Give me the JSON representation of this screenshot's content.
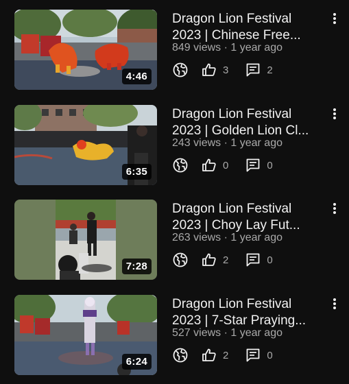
{
  "videos": [
    {
      "title_line1": "Dragon Lion Festival",
      "title_line2": "2023 | Chinese Free...",
      "views": "849 views",
      "age": "1 year ago",
      "duration": "4:46",
      "likes": "3",
      "comments": "2"
    },
    {
      "title_line1": "Dragon Lion Festival",
      "title_line2": "2023 | Golden Lion Cl...",
      "views": "243 views",
      "age": "1 year ago",
      "duration": "6:35",
      "likes": "0",
      "comments": "0"
    },
    {
      "title_line1": "Dragon Lion Festival",
      "title_line2": "2023 | Choy Lay Fut...",
      "views": "263 views",
      "age": "1 year ago",
      "duration": "7:28",
      "likes": "2",
      "comments": "0"
    },
    {
      "title_line1": "Dragon Lion Festival",
      "title_line2": "2023 | 7-Star Praying...",
      "views": "527 views",
      "age": "1 year ago",
      "duration": "6:24",
      "likes": "2",
      "comments": "0"
    }
  ],
  "meta_separator": "·",
  "icons": {
    "visibility": "globe-icon",
    "likes": "thumbs-up-icon",
    "comments": "comment-icon",
    "more": "more-vert-icon"
  },
  "colors": {
    "background": "#0f0f0f",
    "text_primary": "#f1f1f1",
    "text_secondary": "#aaaaaa"
  }
}
